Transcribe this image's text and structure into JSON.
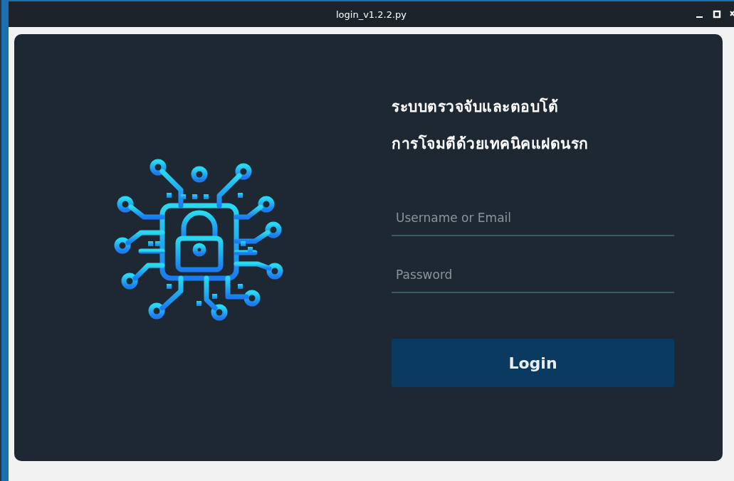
{
  "window": {
    "title": "login_v1.2.2.py"
  },
  "heading": {
    "lines": [
      "ระบบตรวจจับและตอบโต้",
      "การโจมตีด้วยเทคนิคแฝดนรก"
    ]
  },
  "fields": [
    {
      "placeholder": "Username or Email"
    },
    {
      "placeholder": "Password"
    }
  ],
  "button": {
    "label": "Login"
  }
}
